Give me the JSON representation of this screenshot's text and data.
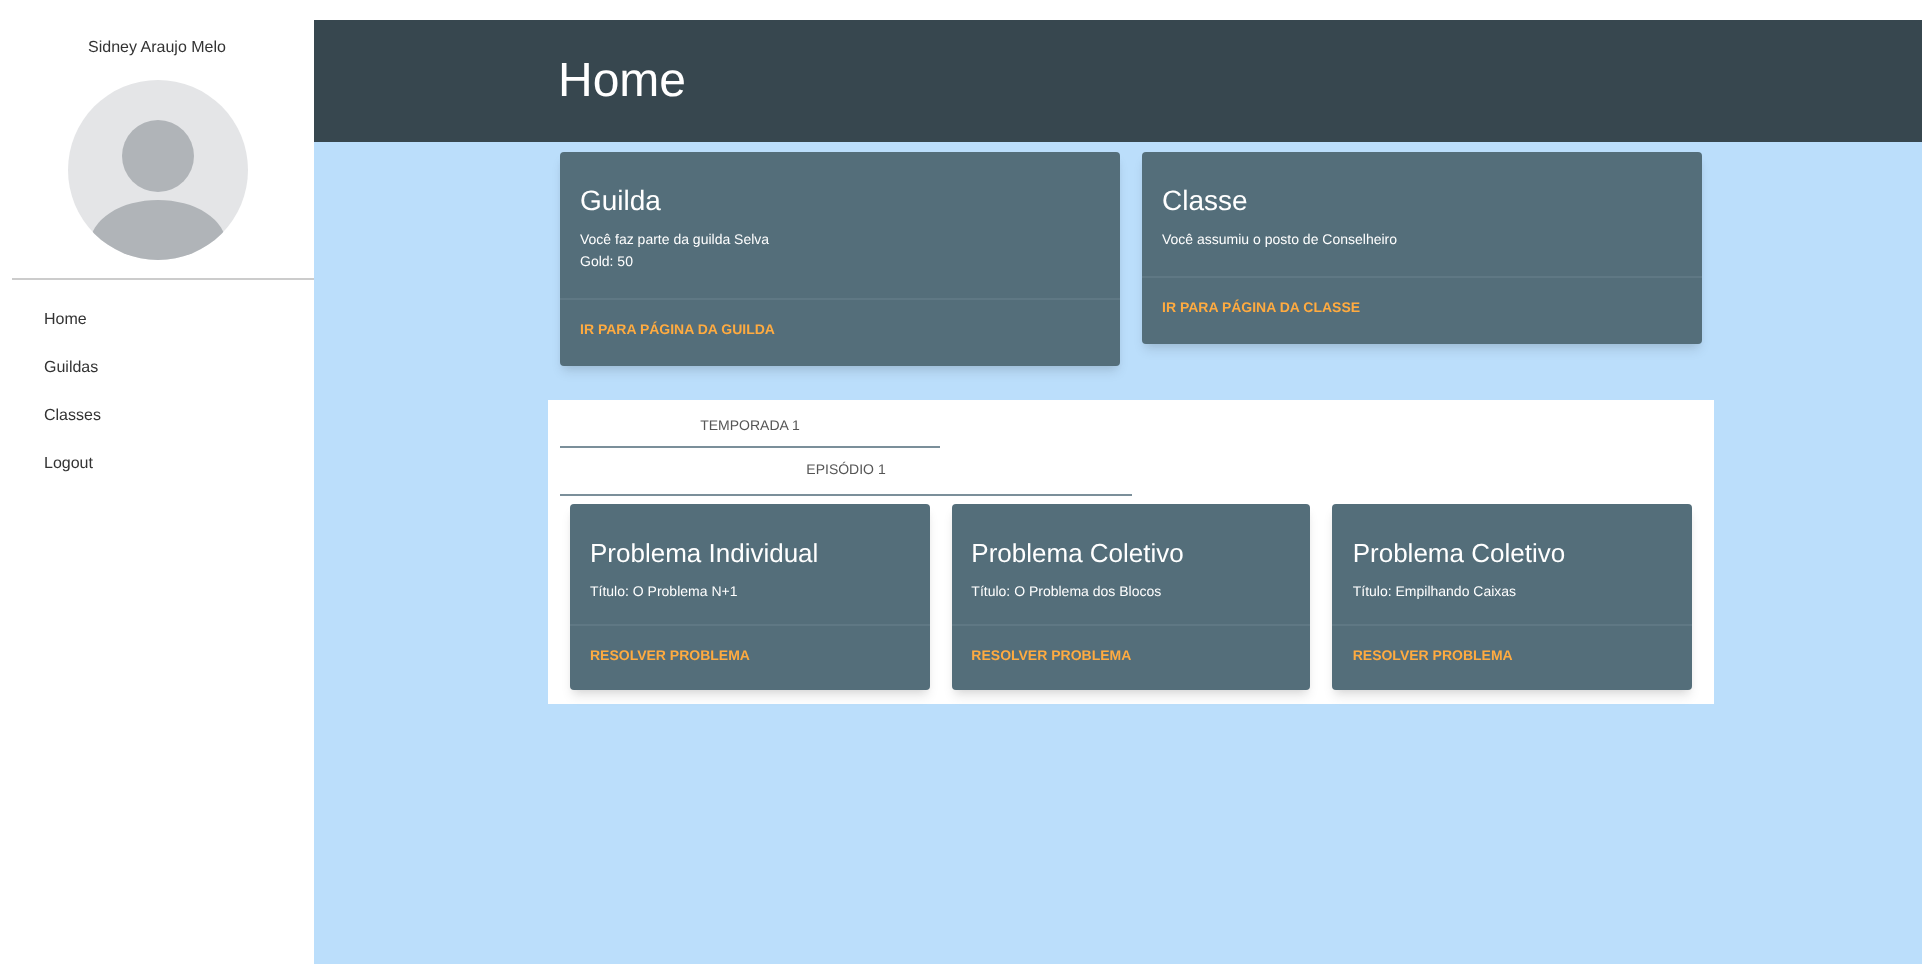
{
  "sidebar": {
    "user_name": "Sidney Araujo Melo",
    "items": [
      {
        "label": "Home"
      },
      {
        "label": "Guildas"
      },
      {
        "label": "Classes"
      },
      {
        "label": "Logout"
      }
    ]
  },
  "header": {
    "title": "Home"
  },
  "info_cards": [
    {
      "title": "Guilda",
      "lines": [
        "Você faz parte da guilda Selva",
        "Gold: 50"
      ],
      "action": "IR PARA PÁGINA DA GUILDA"
    },
    {
      "title": "Classe",
      "lines": [
        "Você assumiu o posto de Conselheiro"
      ],
      "action": "IR PARA PÁGINA DA CLASSE"
    }
  ],
  "season_tab": "TEMPORADA 1",
  "episode_tab": "EPISÓDIO 1",
  "problems": [
    {
      "title": "Problema Individual",
      "subtitle": "Título: O Problema N+1",
      "action": "RESOLVER PROBLEMA"
    },
    {
      "title": "Problema Coletivo",
      "subtitle": "Título: O Problema dos Blocos",
      "action": "RESOLVER PROBLEMA"
    },
    {
      "title": "Problema Coletivo",
      "subtitle": "Título: Empilhando Caixas",
      "action": "RESOLVER PROBLEMA"
    }
  ]
}
